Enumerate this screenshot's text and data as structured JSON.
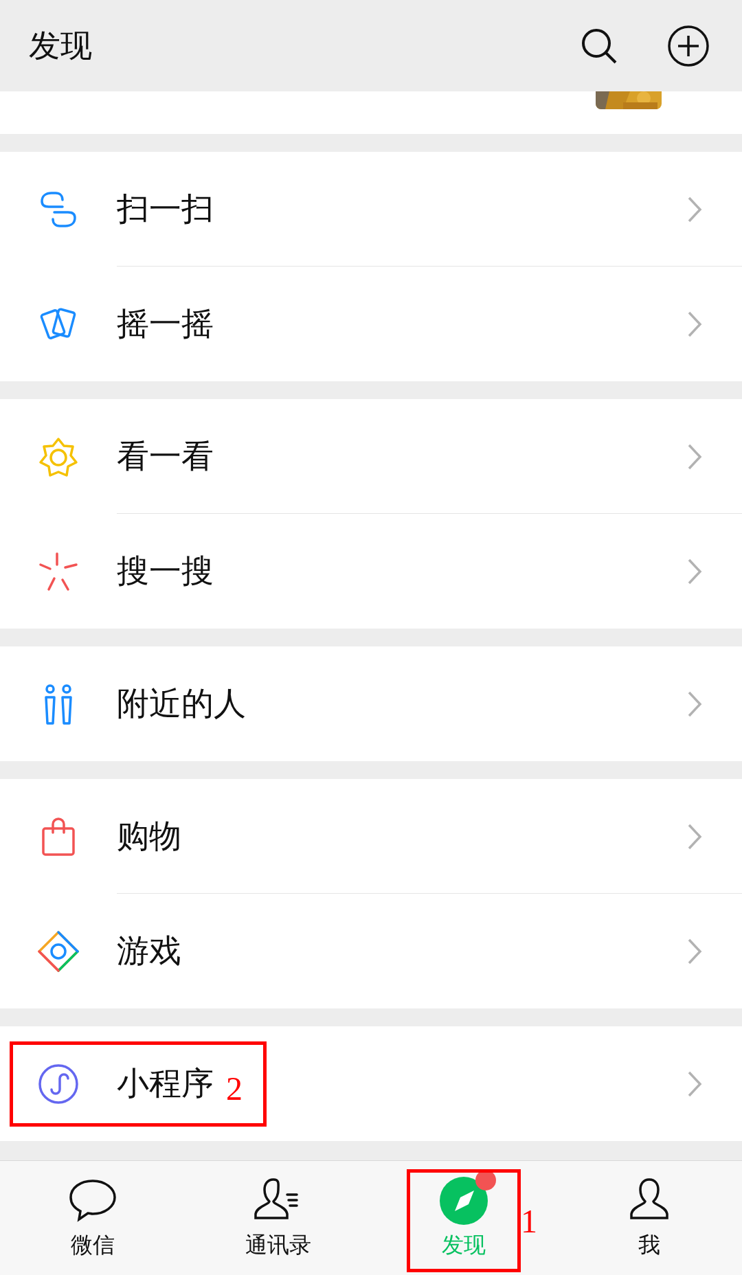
{
  "header": {
    "title": "发现"
  },
  "groups": [
    {
      "items": [
        {
          "label": "扫一扫"
        },
        {
          "label": "摇一摇"
        }
      ]
    },
    {
      "items": [
        {
          "label": "看一看"
        },
        {
          "label": "搜一搜"
        }
      ]
    },
    {
      "items": [
        {
          "label": "附近的人"
        }
      ]
    },
    {
      "items": [
        {
          "label": "购物"
        },
        {
          "label": "游戏"
        }
      ]
    },
    {
      "items": [
        {
          "label": "小程序",
          "annotation": "2"
        }
      ]
    }
  ],
  "tabs": [
    {
      "label": "微信",
      "selected": false,
      "badge": false
    },
    {
      "label": "通讯录",
      "selected": false,
      "badge": false
    },
    {
      "label": "发现",
      "selected": true,
      "badge": true,
      "annotation": "1"
    },
    {
      "label": "我",
      "selected": false,
      "badge": false
    }
  ]
}
